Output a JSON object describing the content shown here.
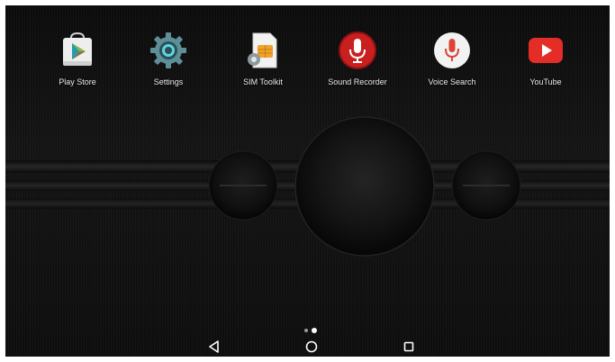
{
  "home_screen": {
    "apps": [
      {
        "label": "Play Store",
        "icon": "play-store-icon"
      },
      {
        "label": "Settings",
        "icon": "gear-icon"
      },
      {
        "label": "SIM Toolkit",
        "icon": "sim-card-icon"
      },
      {
        "label": "Sound Recorder",
        "icon": "microphone-icon"
      },
      {
        "label": "Voice Search",
        "icon": "microphone-icon"
      },
      {
        "label": "YouTube",
        "icon": "youtube-icon"
      }
    ],
    "page_indicator": {
      "pages": 2,
      "current": 2
    }
  },
  "navigation_bar": {
    "buttons": [
      {
        "name": "back",
        "icon": "back-triangle-icon"
      },
      {
        "name": "home",
        "icon": "home-circle-icon"
      },
      {
        "name": "recents",
        "icon": "recents-square-icon"
      }
    ]
  },
  "colors": {
    "label_text": "#e8e8e8",
    "wallpaper_base": "#111111",
    "play_store_green": "#2fb36c",
    "settings_teal": "#5e8f97",
    "sim_orange": "#f0a22b",
    "recorder_red": "#c91f1f",
    "voice_search_red": "#db4437",
    "youtube_red": "#e52d27"
  }
}
